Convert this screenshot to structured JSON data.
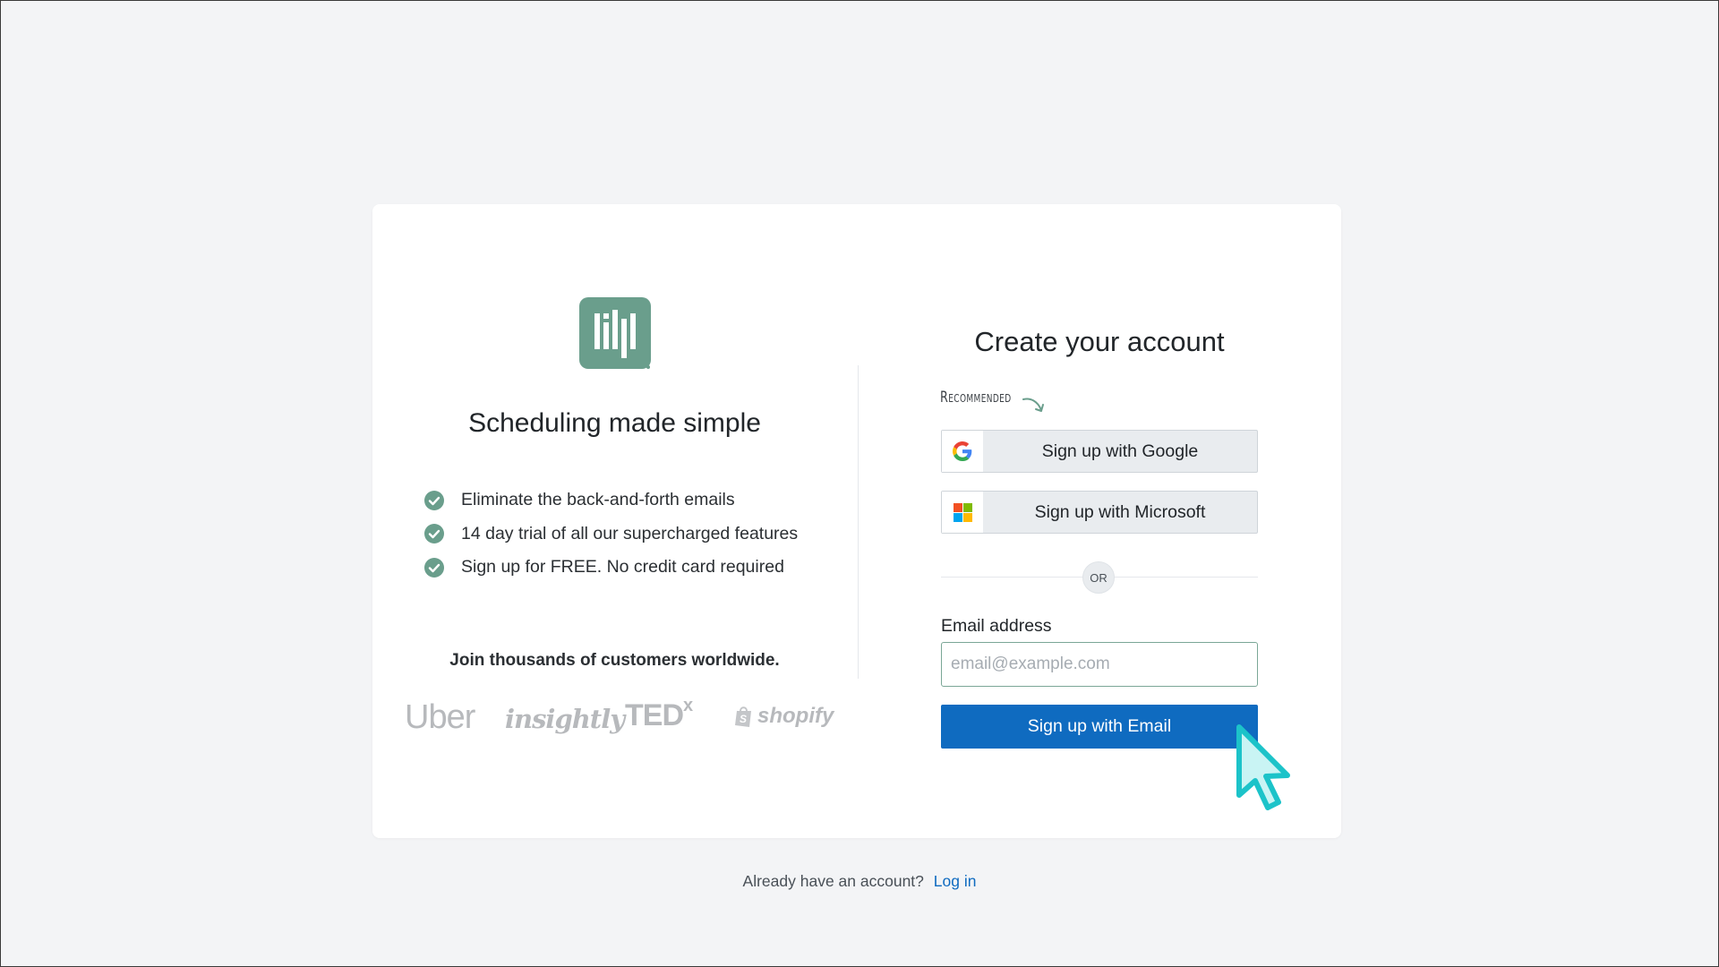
{
  "brand": {
    "logo_icon": "app-logo-bars-icon",
    "accent_color": "#6a9e8c",
    "tagline": "Scheduling made simple"
  },
  "features": [
    {
      "text": "Eliminate the back-and-forth emails",
      "icon": "check-circle-icon"
    },
    {
      "text": "14 day trial of all our supercharged features",
      "icon": "check-circle-icon"
    },
    {
      "text": "Sign up for FREE. No credit card required",
      "icon": "check-circle-icon"
    }
  ],
  "customers": {
    "heading": "Join thousands of customers worldwide.",
    "logos": {
      "uber": "Uber",
      "insightly": "insightly",
      "ted": "TED",
      "ted_sup": "x",
      "shopify": "shopify"
    }
  },
  "signup": {
    "title": "Create your account",
    "recommended": "Recommended",
    "google_label": "Sign up with Google",
    "microsoft_label": "Sign up with Microsoft",
    "or": "OR",
    "email_label": "Email address",
    "email_value": "",
    "email_placeholder": "email@example.com",
    "email_button": "Sign up with Email",
    "primary_color": "#0f6bc0"
  },
  "footer": {
    "prompt": "Already have an account?",
    "login_link": "Log in"
  }
}
